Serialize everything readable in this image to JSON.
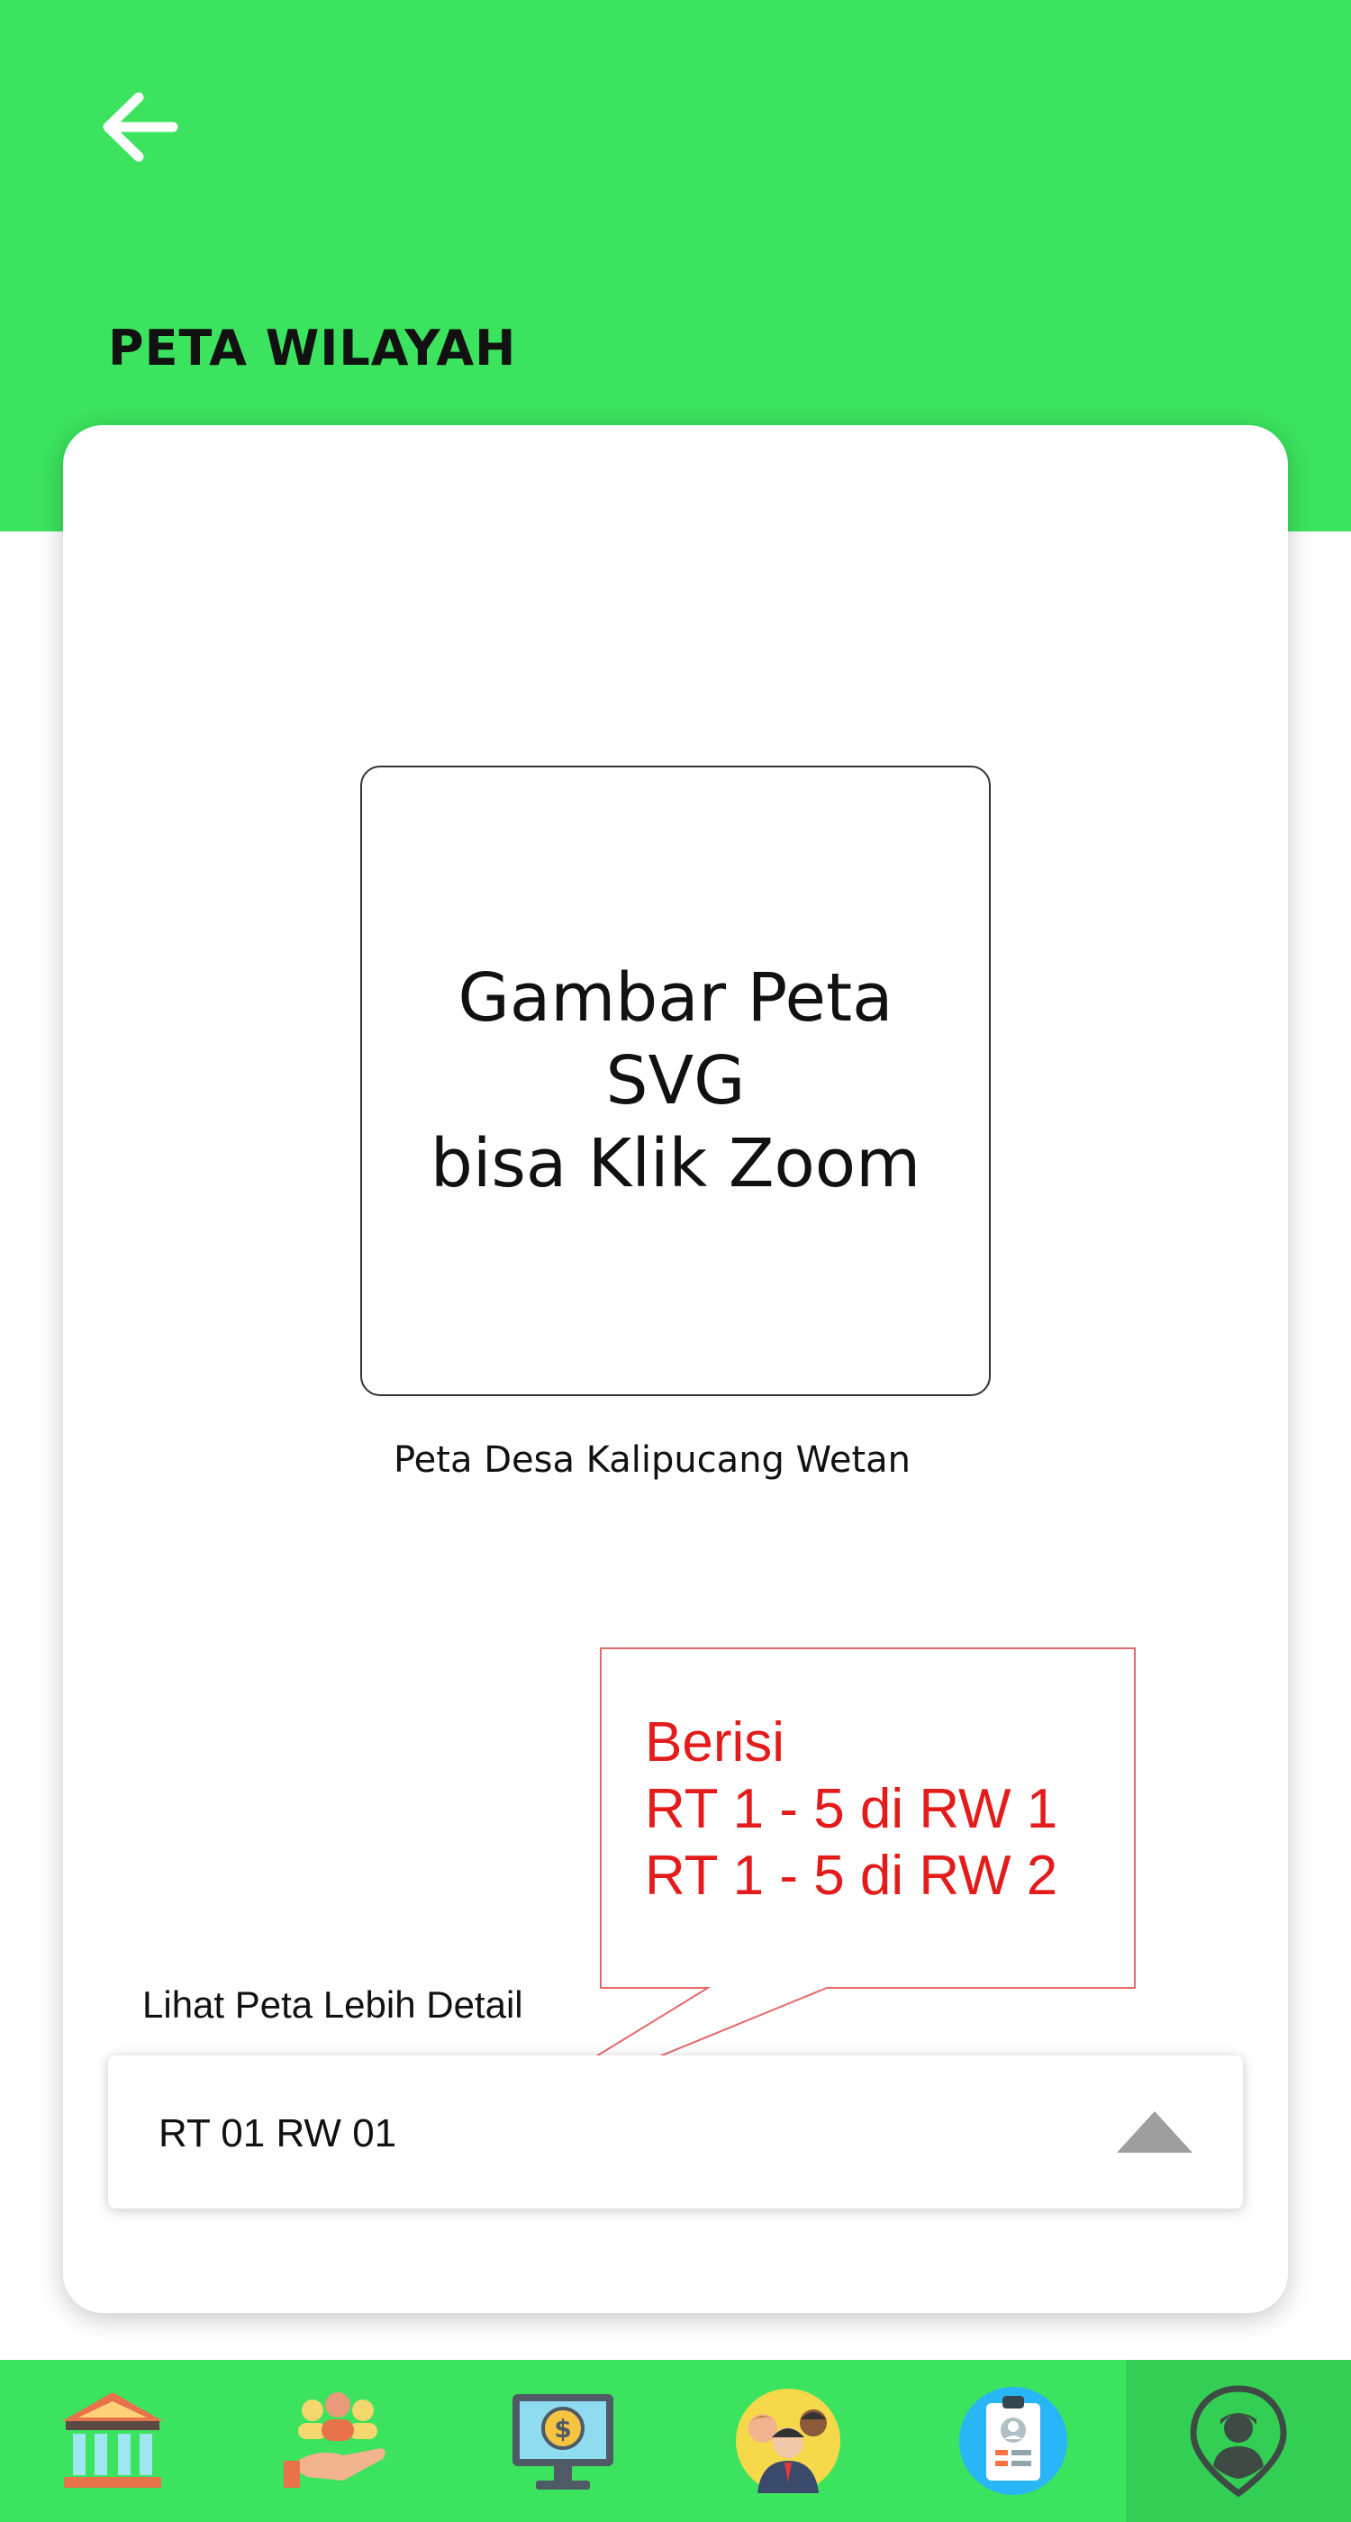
{
  "header": {
    "back_icon": "arrow-left-icon",
    "title": "PETA WILAYAH",
    "color": "#3be35e"
  },
  "map": {
    "placeholder_text": "Gambar Peta\nSVG\nbisa Klik Zoom",
    "caption": "Peta Desa Kalipucang Wetan"
  },
  "annotation": {
    "text": "Berisi\nRT 1 - 5 di RW 1\nRT 1 - 5 di RW 2",
    "color": "#e31b1b"
  },
  "detail": {
    "label": "Lihat Peta Lebih Detail",
    "selected_value": "RT 01 RW 01",
    "arrow_icon": "triangle-up-icon"
  },
  "bottom_nav": {
    "items": [
      {
        "icon": "government-building-icon"
      },
      {
        "icon": "community-hand-icon"
      },
      {
        "icon": "finance-monitor-icon"
      },
      {
        "icon": "people-group-icon"
      },
      {
        "icon": "id-card-icon"
      },
      {
        "icon": "location-person-icon",
        "active": true
      }
    ]
  }
}
